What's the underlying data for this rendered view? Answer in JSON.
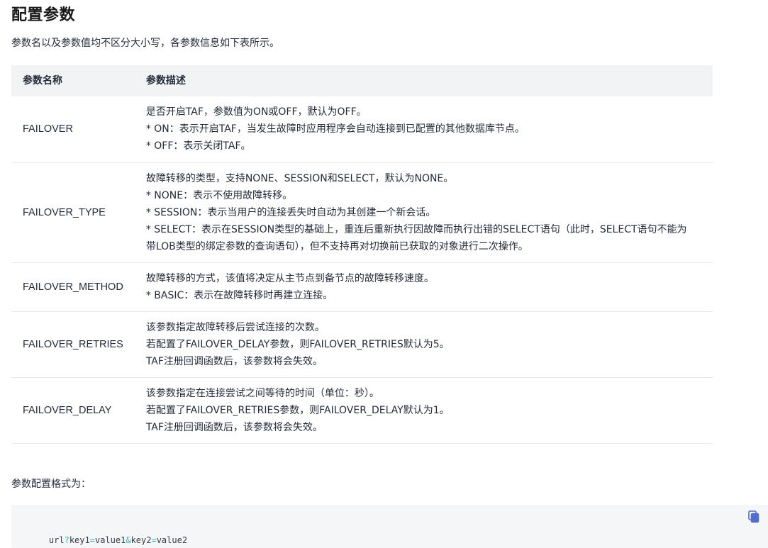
{
  "page": {
    "title": "配置参数",
    "intro": "参数名以及参数值均不区分大小写，各参数信息如下表所示。"
  },
  "table": {
    "headers": [
      "参数名称",
      "参数描述"
    ],
    "rows": [
      {
        "name": "FAILOVER",
        "desc": [
          "是否开启TAF，参数值为ON或OFF，默认为OFF。",
          "* ON：表示开启TAF，当发生故障时应用程序会自动连接到已配置的其他数据库节点。",
          "* OFF：表示关闭TAF。"
        ]
      },
      {
        "name": "FAILOVER_TYPE",
        "desc": [
          "故障转移的类型，支持NONE、SESSION和SELECT，默认为NONE。",
          "* NONE：表示不使用故障转移。",
          "* SESSION：表示当用户的连接丢失时自动为其创建一个新会话。",
          "* SELECT：表示在SESSION类型的基础上，重连后重新执行因故障而执行出错的SELECT语句（此时，SELECT语句不能为带LOB类型的绑定参数的查询语句），但不支持再对切换前已获取的对象进行二次操作。"
        ]
      },
      {
        "name": "FAILOVER_METHOD",
        "desc": [
          "故障转移的方式，该值将决定从主节点到备节点的故障转移速度。",
          "* BASIC：表示在故障转移时再建立连接。"
        ]
      },
      {
        "name": "FAILOVER_RETRIES",
        "desc": [
          "该参数指定故障转移后尝试连接的次数。",
          "若配置了FAILOVER_DELAY参数，则FAILOVER_RETRIES默认为5。",
          "TAF注册回调函数后，该参数将会失效。"
        ]
      },
      {
        "name": "FAILOVER_DELAY",
        "desc": [
          "该参数指定在连接尝试之间等待的时间（单位：秒）。",
          "若配置了FAILOVER_RETRIES参数，则FAILOVER_DELAY默认为1。",
          "TAF注册回调函数后，该参数将会失效。"
        ]
      }
    ]
  },
  "format": {
    "label": "参数配置格式为：",
    "code_parts": [
      "url",
      "?",
      "key1",
      "=",
      "value1",
      "&",
      "key2",
      "=",
      "value2"
    ],
    "copy_icon": "copy-icon",
    "copy_icon_color": "#526ecc"
  }
}
